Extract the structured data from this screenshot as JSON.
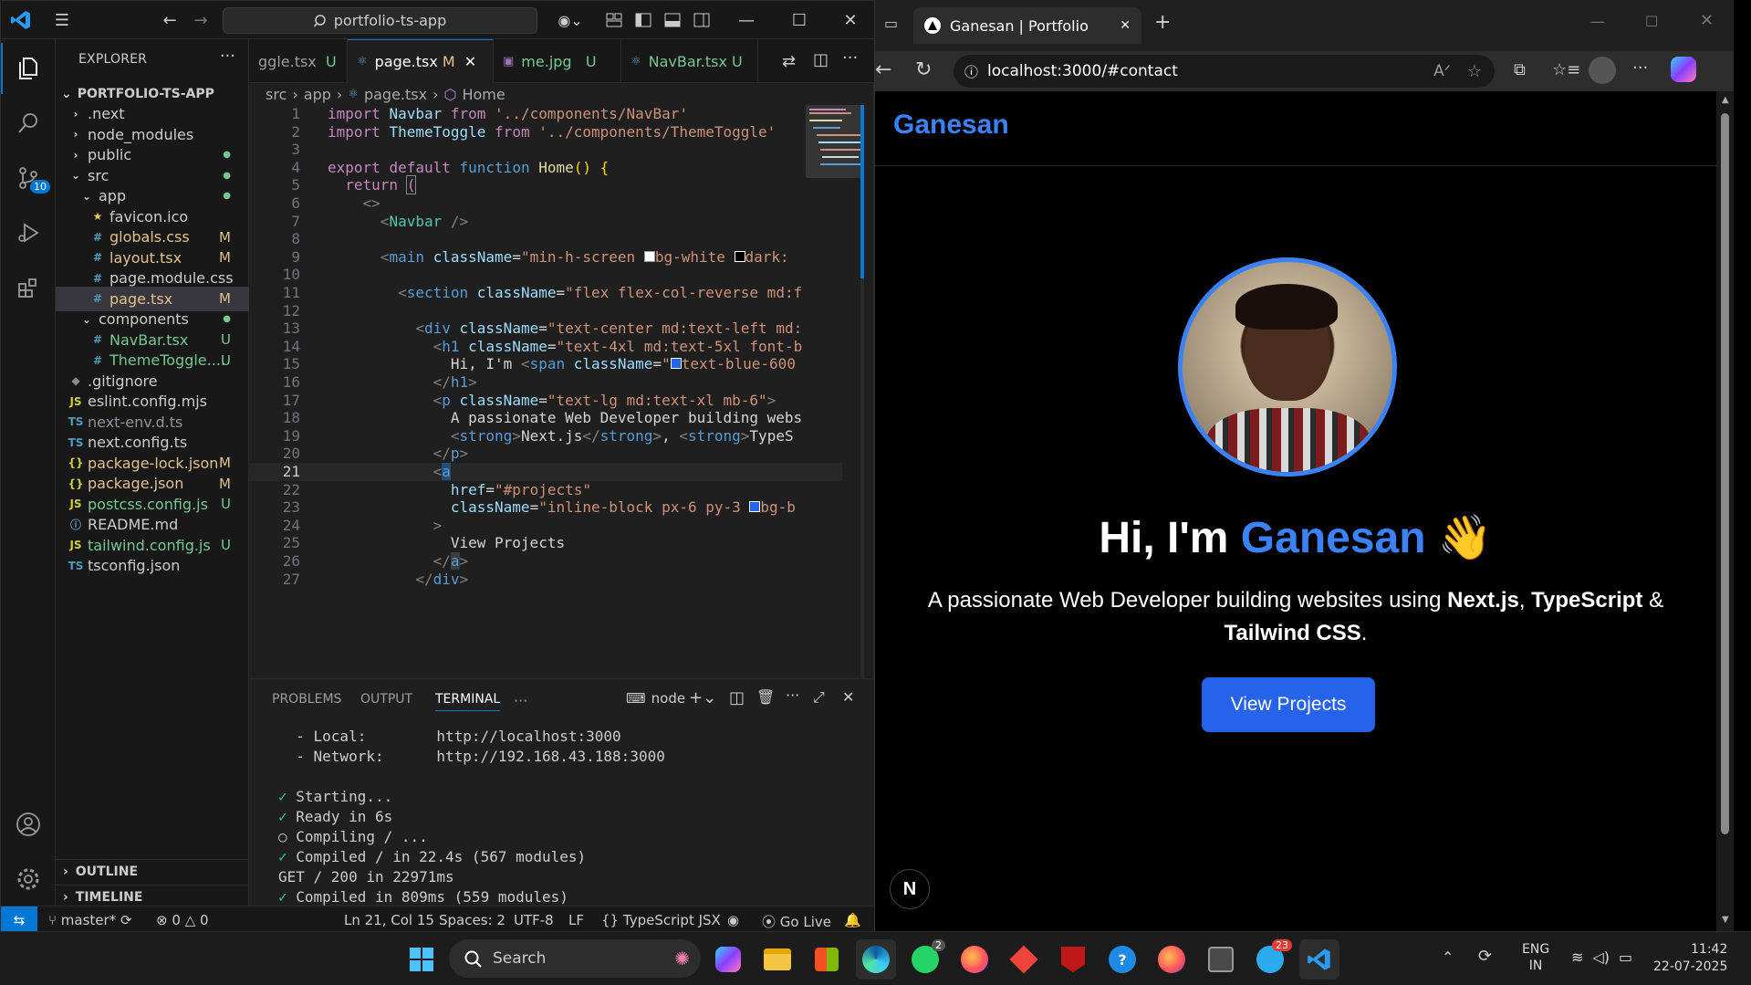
{
  "vscode": {
    "search_text": "portfolio-ts-app",
    "explorer_title": "EXPLORER",
    "root_folder": "PORTFOLIO-TS-APP",
    "source_control_badge": "10",
    "tree": [
      {
        "label": ".next",
        "kind": "folder-closed",
        "depth": 1,
        "status": ""
      },
      {
        "label": "node_modules",
        "kind": "folder-closed",
        "depth": 1,
        "status": ""
      },
      {
        "label": "public",
        "kind": "folder-closed",
        "depth": 1,
        "status": "●"
      },
      {
        "label": "src",
        "kind": "folder-open",
        "depth": 1,
        "status": "●"
      },
      {
        "label": "app",
        "kind": "folder-open",
        "depth": 2,
        "status": "●"
      },
      {
        "label": "favicon.ico",
        "kind": "star",
        "depth": 3,
        "status": ""
      },
      {
        "label": "globals.css",
        "kind": "css",
        "depth": 3,
        "status": "M"
      },
      {
        "label": "layout.tsx",
        "kind": "tsx",
        "depth": 3,
        "status": "M"
      },
      {
        "label": "page.module.css",
        "kind": "css",
        "depth": 3,
        "status": ""
      },
      {
        "label": "page.tsx",
        "kind": "tsx",
        "depth": 3,
        "status": "M"
      },
      {
        "label": "components",
        "kind": "folder-open",
        "depth": 2,
        "status": "●"
      },
      {
        "label": "NavBar.tsx",
        "kind": "tsx",
        "depth": 3,
        "status": "U"
      },
      {
        "label": "ThemeToggle....",
        "kind": "tsx",
        "depth": 3,
        "status": "U"
      },
      {
        "label": ".gitignore",
        "kind": "git",
        "depth": 1,
        "status": ""
      },
      {
        "label": "eslint.config.mjs",
        "kind": "js",
        "depth": 1,
        "status": ""
      },
      {
        "label": "next-env.d.ts",
        "kind": "ts",
        "depth": 1,
        "status": ""
      },
      {
        "label": "next.config.ts",
        "kind": "ts",
        "depth": 1,
        "status": ""
      },
      {
        "label": "package-lock.json",
        "kind": "json",
        "depth": 1,
        "status": "M"
      },
      {
        "label": "package.json",
        "kind": "json",
        "depth": 1,
        "status": "M"
      },
      {
        "label": "postcss.config.js",
        "kind": "js",
        "depth": 1,
        "status": "U"
      },
      {
        "label": "README.md",
        "kind": "info",
        "depth": 1,
        "status": ""
      },
      {
        "label": "tailwind.config.js",
        "kind": "js",
        "depth": 1,
        "status": "U"
      },
      {
        "label": "tsconfig.json",
        "kind": "tsjson",
        "depth": 1,
        "status": ""
      }
    ],
    "outline": "OUTLINE",
    "timeline": "TIMELINE",
    "tabs": [
      {
        "label": "ggle.tsx",
        "status": "U",
        "active": false
      },
      {
        "label": "page.tsx",
        "status": "M",
        "active": true
      },
      {
        "label": "me.jpg",
        "status": "U",
        "active": false
      },
      {
        "label": "NavBar.tsx",
        "status": "U",
        "active": false
      }
    ],
    "breadcrumb": [
      "src",
      "app",
      "page.tsx",
      "Home"
    ],
    "code_lines": [
      {
        "n": "1",
        "html": "<span class='ctl'>import</span> <span class='att'>Navbar</span> <span class='ctl'>from</span> <span class='str'>'../components/NavBar'</span>"
      },
      {
        "n": "2",
        "html": "<span class='ctl'>import</span> <span class='att'>ThemeToggle</span> <span class='ctl'>from</span> <span class='str'>'../components/ThemeToggle'</span>"
      },
      {
        "n": "3",
        "html": ""
      },
      {
        "n": "4",
        "html": "<span class='ctl'>export</span> <span class='ctl'>default</span> <span class='kw'>function</span> <span class='fn'>Home</span><span class='br'>()</span> <span class='br'>{</span>"
      },
      {
        "n": "5",
        "html": "  <span class='ctl'>return</span> <span class='ctl' style='outline:1px solid #888'>(</span>"
      },
      {
        "n": "6",
        "html": "    <span class='gray'>&lt;&gt;</span>"
      },
      {
        "n": "7",
        "html": "      <span class='gray'>&lt;</span><span class='tag'>Navbar</span> <span class='gray'>/&gt;</span>"
      },
      {
        "n": "8",
        "html": ""
      },
      {
        "n": "9",
        "html": "      <span class='gray'>&lt;</span><span class='kw'>main</span> <span class='att'>className</span><span class='txt'>=</span><span class='str'>\"min-h-screen <span style='display:inline-block;width:12px;height:12px;background:#fff;border:1px solid #999'></span>bg-white <span style='display:inline-block;width:12px;height:12px;background:#000;border:1px solid #fff'></span>dark:</span>"
      },
      {
        "n": "10",
        "html": ""
      },
      {
        "n": "11",
        "html": "        <span class='gray'>&lt;</span><span class='kw'>section</span> <span class='att'>className</span><span class='txt'>=</span><span class='str'>\"flex flex-col-reverse md:f</span>"
      },
      {
        "n": "12",
        "html": ""
      },
      {
        "n": "13",
        "html": "          <span class='gray'>&lt;</span><span class='kw'>div</span> <span class='att'>className</span><span class='txt'>=</span><span class='str'>\"text-center md:text-left md:</span>"
      },
      {
        "n": "14",
        "html": "            <span class='gray'>&lt;</span><span class='kw'>h1</span> <span class='att'>className</span><span class='txt'>=</span><span class='str'>\"text-4xl md:text-5xl font-b</span>"
      },
      {
        "n": "15",
        "html": "              <span class='txt'>Hi, I'm </span><span class='gray'>&lt;</span><span class='kw'>span</span> <span class='att'>className</span><span class='txt'>=</span><span class='str'>\"<span style='display:inline-block;width:12px;height:12px;background:#2563eb;border:1px solid #fff'></span>text-blue-600</span>"
      },
      {
        "n": "16",
        "html": "            <span class='gray'>&lt;/</span><span class='kw'>h1</span><span class='gray'>&gt;</span>"
      },
      {
        "n": "17",
        "html": "            <span class='gray'>&lt;</span><span class='kw'>p</span> <span class='att'>className</span><span class='txt'>=</span><span class='str'>\"text-lg md:text-xl mb-6\"</span><span class='gray'>&gt;</span>"
      },
      {
        "n": "18",
        "html": "              <span class='txt'>A passionate Web Developer building webs</span>"
      },
      {
        "n": "19",
        "html": "              <span class='gray'>&lt;</span><span class='kw'>strong</span><span class='gray'>&gt;</span><span class='txt'>Next.js</span><span class='gray'>&lt;/</span><span class='kw'>strong</span><span class='gray'>&gt;</span><span class='txt'>, </span><span class='gray'>&lt;</span><span class='kw'>strong</span><span class='gray'>&gt;</span><span class='txt'>TypeS</span>"
      },
      {
        "n": "20",
        "html": "            <span class='gray'>&lt;/</span><span class='kw'>p</span><span class='gray'>&gt;</span>"
      },
      {
        "n": "21",
        "html": "            <span class='gray'>&lt;</span><span class='kw' style='background:#264f78'>a</span>"
      },
      {
        "n": "22",
        "html": "              <span class='att'>href</span><span class='txt'>=</span><span class='str'>\"#projects\"</span>"
      },
      {
        "n": "23",
        "html": "              <span class='att'>className</span><span class='txt'>=</span><span class='str'>\"inline-block px-6 py-3 <span style='display:inline-block;width:12px;height:12px;background:#2563eb;border:1px solid #fff'></span>bg-b</span>"
      },
      {
        "n": "24",
        "html": "            <span class='gray'>&gt;</span>"
      },
      {
        "n": "25",
        "html": "              <span class='txt'>View Projects</span>"
      },
      {
        "n": "26",
        "html": "            <span class='gray'>&lt;/</span><span class='kw' style='background:#3a3d41'>a</span><span class='gray'>&gt;</span>"
      },
      {
        "n": "27",
        "html": "          <span class='gray'>&lt;/</span><span class='kw'>div</span><span class='gray'>&gt;</span>"
      }
    ],
    "panel_tabs": [
      "PROBLEMS",
      "OUTPUT",
      "TERMINAL"
    ],
    "terminal_name": "node",
    "terminal_lines": [
      {
        "check": "",
        "text": "  - Local:        http://localhost:3000"
      },
      {
        "check": "",
        "text": "  - Network:      http://192.168.43.188:3000"
      },
      {
        "check": "",
        "text": ""
      },
      {
        "check": "✓",
        "text": " Starting..."
      },
      {
        "check": "✓",
        "text": " Ready in 6s"
      },
      {
        "check": "○",
        "text": " Compiling / ..."
      },
      {
        "check": "✓",
        "text": " Compiled / in 22.4s (567 modules)"
      },
      {
        "check": "",
        "text": "GET / 200 in 22971ms"
      },
      {
        "check": "✓",
        "text": " Compiled in 809ms (559 modules)"
      }
    ],
    "status": {
      "branch": "master*",
      "errors": "0",
      "warnings": "0",
      "position": "Ln 21, Col 15",
      "spaces": "Spaces: 2",
      "encoding": "UTF-8",
      "eol": "LF",
      "language": "TypeScript JSX",
      "golive": "Go Live"
    }
  },
  "browser": {
    "tab_title": "Ganesan | Portfolio",
    "url": "localhost:3000/#contact",
    "brand": "Ganesan",
    "hero_prefix": "Hi, I'm ",
    "hero_name": "Ganesan",
    "hero_emoji": "👋",
    "tagline_prefix": "A passionate Web Developer building websites using ",
    "tech1": "Next.js",
    "sep1": ", ",
    "tech2": "TypeScript",
    "sep2": " & ",
    "tech3": "Tailwind CSS",
    "tagline_end": ".",
    "cta": "View Projects",
    "next_badge": "N",
    "accent": "#3b82f6"
  },
  "taskbar": {
    "search": "Search",
    "whatsapp_badge": "2",
    "telegram_badge": "23",
    "lang1": "ENG",
    "lang2": "IN",
    "time": "11:42",
    "date": "22-07-2025"
  }
}
